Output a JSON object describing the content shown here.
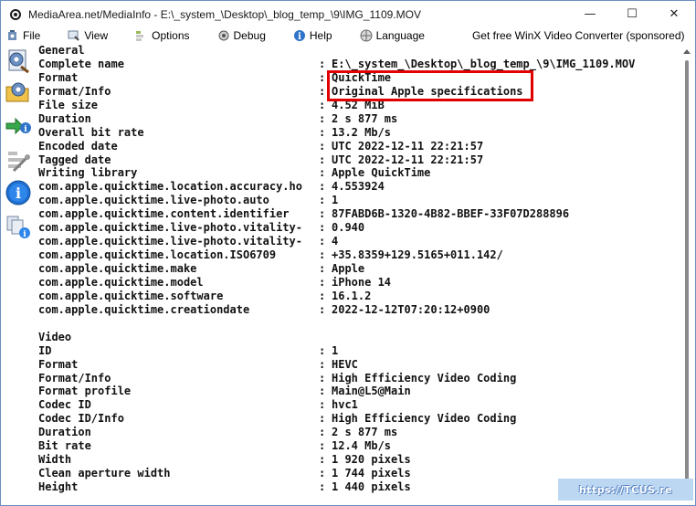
{
  "window": {
    "title": "MediaArea.net/MediaInfo - E:\\_system_\\Desktop\\_blog_temp_\\9\\IMG_1109.MOV",
    "controls": {
      "minimize": "—",
      "maximize": "☐",
      "close": "✕"
    }
  },
  "menu": {
    "items": [
      {
        "label": "File",
        "icon": "file-icon"
      },
      {
        "label": "View",
        "icon": "view-icon"
      },
      {
        "label": "Options",
        "icon": "options-icon"
      },
      {
        "label": "Debug",
        "icon": "debug-icon"
      },
      {
        "label": "Help",
        "icon": "help-icon"
      },
      {
        "label": "Language",
        "icon": "language-icon"
      }
    ],
    "sponsored": "Get free WinX Video Converter (sponsored)"
  },
  "sidebar": {
    "icons": [
      "open-file-icon",
      "open-folder-icon",
      "export-info-icon",
      "preferences-icon",
      "about-info-icon",
      "batch-icon"
    ]
  },
  "report": {
    "general_header": "General",
    "general": [
      {
        "key": "Complete name",
        "value": "E:\\_system_\\Desktop\\_blog_temp_\\9\\IMG_1109.MOV"
      },
      {
        "key": "Format",
        "value": "QuickTime"
      },
      {
        "key": "Format/Info",
        "value": "Original Apple specifications"
      },
      {
        "key": "File size",
        "value": "4.52 MiB"
      },
      {
        "key": "Duration",
        "value": "2 s 877 ms"
      },
      {
        "key": "Overall bit rate",
        "value": "13.2 Mb/s"
      },
      {
        "key": "Encoded date",
        "value": "UTC 2022-12-11 22:21:57"
      },
      {
        "key": "Tagged date",
        "value": "UTC 2022-12-11 22:21:57"
      },
      {
        "key": "Writing library",
        "value": "Apple QuickTime"
      },
      {
        "key": "com.apple.quicktime.location.accuracy.ho",
        "value": "4.553924"
      },
      {
        "key": "com.apple.quicktime.live-photo.auto",
        "value": "1"
      },
      {
        "key": "com.apple.quicktime.content.identifier",
        "value": "87FABD6B-1320-4B82-BBEF-33F07D288896"
      },
      {
        "key": "com.apple.quicktime.live-photo.vitality-",
        "value": "0.940"
      },
      {
        "key": "com.apple.quicktime.live-photo.vitality-",
        "value": "4"
      },
      {
        "key": "com.apple.quicktime.location.ISO6709",
        "value": "+35.8359+129.5165+011.142/"
      },
      {
        "key": "com.apple.quicktime.make",
        "value": "Apple"
      },
      {
        "key": "com.apple.quicktime.model",
        "value": "iPhone 14"
      },
      {
        "key": "com.apple.quicktime.software",
        "value": "16.1.2"
      },
      {
        "key": "com.apple.quicktime.creationdate",
        "value": "2022-12-12T07:20:12+0900"
      }
    ],
    "video_header": "Video",
    "video": [
      {
        "key": "ID",
        "value": "1"
      },
      {
        "key": "Format",
        "value": "HEVC"
      },
      {
        "key": "Format/Info",
        "value": "High Efficiency Video Coding"
      },
      {
        "key": "Format profile",
        "value": "Main@L5@Main"
      },
      {
        "key": "Codec ID",
        "value": "hvc1"
      },
      {
        "key": "Codec ID/Info",
        "value": "High Efficiency Video Coding"
      },
      {
        "key": "Duration",
        "value": "2 s 877 ms"
      },
      {
        "key": "Bit rate",
        "value": "12.4 Mb/s"
      },
      {
        "key": "Width",
        "value": "1 920 pixels"
      },
      {
        "key": "Clean aperture width",
        "value": "1 744 pixels"
      },
      {
        "key": "Height",
        "value": "1 440 pixels"
      }
    ]
  },
  "watermark": {
    "text": "https://TCUS.re"
  },
  "colors": {
    "highlight": "#e00000",
    "watermark_bg": "#bcd7f2"
  }
}
